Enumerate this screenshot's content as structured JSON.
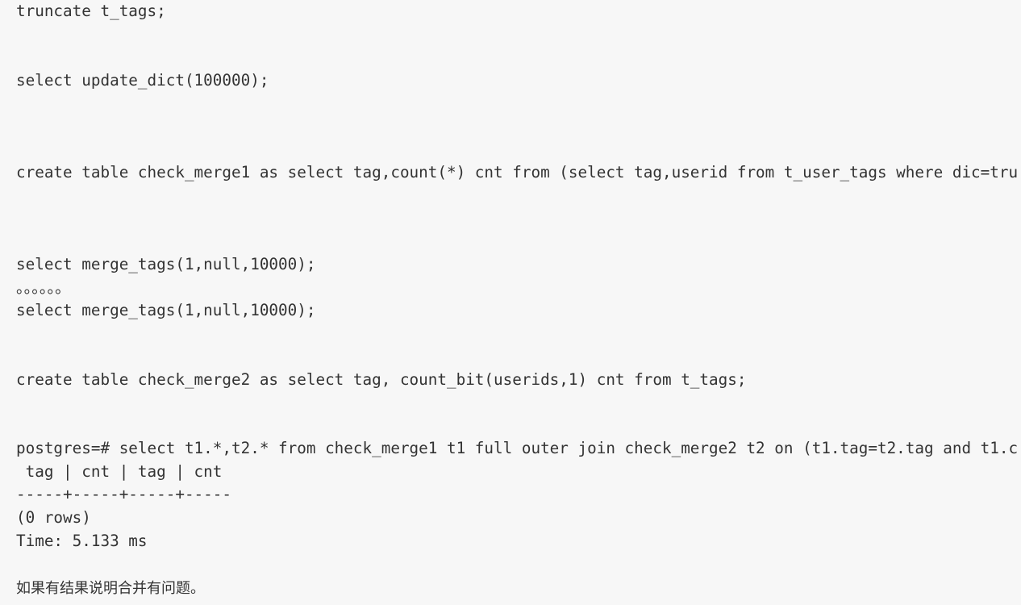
{
  "code_lines": [
    "truncate t_tags;",
    "",
    "",
    "select update_dict(100000);",
    "",
    "",
    "",
    "create table check_merge1 as select tag,count(*) cnt from (select tag,userid from t_user_tags where dic=tru",
    "",
    "",
    "",
    "select merge_tags(1,null,10000);",
    "。。。。。。",
    "select merge_tags(1,null,10000);",
    "",
    "",
    "create table check_merge2 as select tag, count_bit(userids,1) cnt from t_tags;",
    "",
    "",
    "postgres=# select t1.*,t2.* from check_merge1 t1 full outer join check_merge2 t2 on (t1.tag=t2.tag and t1.c",
    " tag | cnt | tag | cnt ",
    "-----+-----+-----+-----",
    "(0 rows)",
    "Time: 5.133 ms"
  ],
  "note": "如果有结果说明合并有问题。"
}
